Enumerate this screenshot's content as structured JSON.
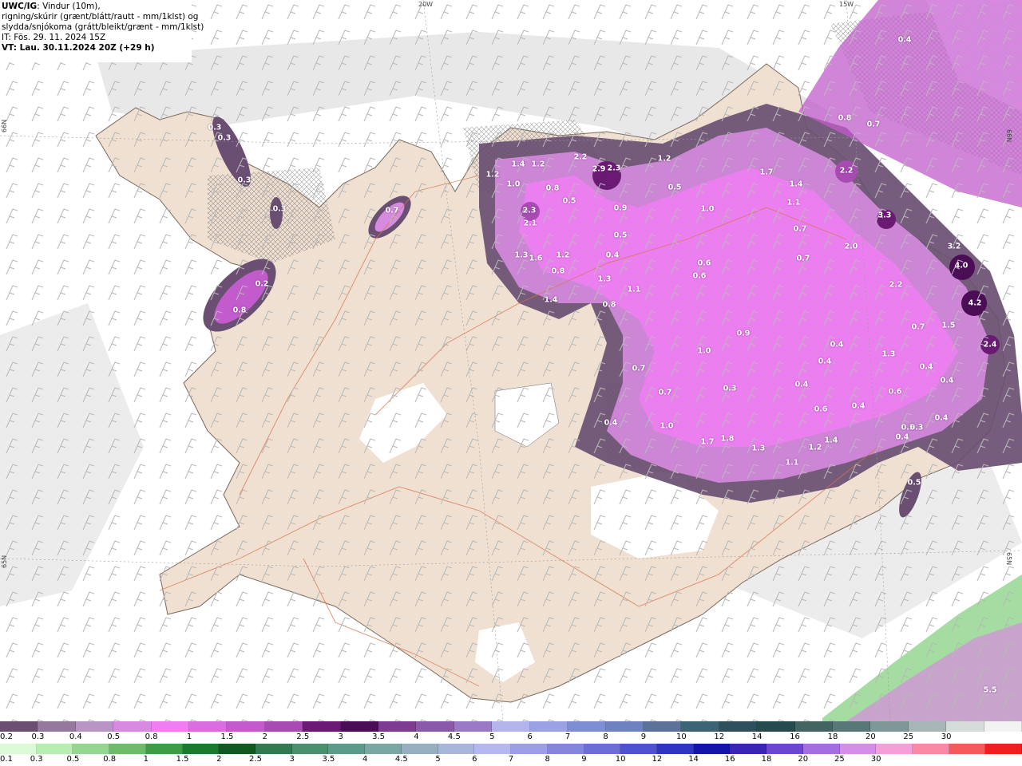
{
  "header": {
    "model_label": "UWC/IG",
    "line1_rest": ": Vindur (10m),",
    "line2": "rigning/skúrir (grænt/blátt/rautt - mm/1klst) og",
    "line3": "slydda/snjókoma (grátt/bleikt/grænt - mm/1klst)",
    "it_label": "IT",
    "it_value": ": Fös. 29. 11. 2024 15Z",
    "vt_label": "VT",
    "vt_value": ": Lau. 30.11.2024 20Z (+29 h)"
  },
  "grid_labels": {
    "lon_20w": "20W",
    "lon_15w": "15W",
    "lat_66n_left": "66N",
    "lat_66n_right": "66N",
    "lat_65n_left": "65N",
    "lat_65n_right": "65N"
  },
  "values": [
    "0.4",
    "0.3",
    "0.3",
    "0.3",
    "0.3",
    "0.7",
    "0.2",
    "0.8",
    "1.2",
    "1.4",
    "1.2",
    "2.2",
    "2.9",
    "2.3",
    "1.2",
    "1.0",
    "0.8",
    "0.5",
    "0.9",
    "2.3",
    "2.1",
    "1.3",
    "1.6",
    "1.2",
    "0.8",
    "1.4",
    "0.5",
    "0.4",
    "1.3",
    "1.1",
    "0.8",
    "0.8",
    "0.7",
    "0.5",
    "1.0",
    "0.6",
    "0.6",
    "1.7",
    "1.4",
    "2.2",
    "1.1",
    "0.7",
    "0.7",
    "0.4",
    "0.4",
    "3.3",
    "2.0",
    "2.2",
    "3.2",
    "4.0",
    "4.2",
    "2.4",
    "1.5",
    "0.7",
    "0.9",
    "1.0",
    "0.7",
    "0.7",
    "0.3",
    "0.4",
    "0.4",
    "1.3",
    "0.6",
    "0.4",
    "0.6",
    "0.5",
    "0.4",
    "0.3",
    "0.4",
    "0.4",
    "0.4",
    "1.0",
    "1.7",
    "1.8",
    "1.3",
    "1.1",
    "1.2",
    "1.4",
    "0.5",
    "5.5"
  ],
  "snow_scale": {
    "colors": [
      "#6a4f72",
      "#94789e",
      "#b895c4",
      "#d78be0",
      "#f07ef2",
      "#d96ee0",
      "#c25ccc",
      "#a84bb3",
      "#6b1a74",
      "#4b0e56",
      "#7d3c8f",
      "#8a59a8",
      "#9a7ac4",
      "#b4b4ec",
      "#9aa2e4",
      "#7e8ed2",
      "#6f82c0",
      "#5c7299",
      "#3d6474",
      "#2e4f5c",
      "#264b4c",
      "#436460",
      "#587878",
      "#7e9898",
      "#a6b6b4",
      "#d6dcd9",
      "#f2f2f2"
    ],
    "labels": [
      "0.2",
      "0.3",
      "0.4",
      "0.5",
      "0.8",
      "1",
      "1.5",
      "2",
      "2.5",
      "3",
      "3.5",
      "4",
      "4.5",
      "5",
      "6",
      "7",
      "8",
      "9",
      "10",
      "12",
      "14",
      "16",
      "18",
      "20",
      "25",
      "30"
    ]
  },
  "rain_scale": {
    "colors": [
      "#dcfad8",
      "#b8eeb2",
      "#94d690",
      "#6cbc6a",
      "#3e9c44",
      "#1b7a2e",
      "#0e5a20",
      "#2f7a4e",
      "#4a8f6e",
      "#5c9a8a",
      "#7aa6a4",
      "#96b0c2",
      "#a8b6dc",
      "#b4b8ee",
      "#9c9ee6",
      "#8486dc",
      "#6c6ed6",
      "#4f52d0",
      "#3034c2",
      "#1414a8",
      "#3a24b6",
      "#6c46d0",
      "#a46ee0",
      "#d48ee8",
      "#f4a0d8",
      "#f88aa6",
      "#f45a5a",
      "#f01e1e"
    ],
    "labels": [
      "0.1",
      "0.3",
      "0.5",
      "0.8",
      "1",
      "1.5",
      "2",
      "2.5",
      "3",
      "3.5",
      "4",
      "4.5",
      "5",
      "6",
      "7",
      "8",
      "9",
      "10",
      "12",
      "14",
      "16",
      "18",
      "20",
      "25",
      "30"
    ]
  }
}
